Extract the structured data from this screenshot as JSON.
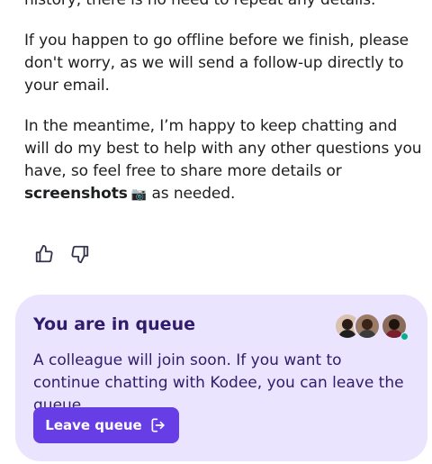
{
  "message": {
    "paragraph1": "history, there is no need to repeat any details.",
    "paragraph2": "If you happen to go offline before we finish, please don't worry, as we will send a follow-up directly to your email.",
    "paragraph3_before": "In the meantime, I’m happy to keep chatting and will do my best to help with any other questions you have, so feel free to share more details or ",
    "paragraph3_bold": "screenshots",
    "paragraph3_emoji": "📷",
    "paragraph3_after": " as needed."
  },
  "feedback": {
    "thumbs_up_icon": "thumbs-up-icon",
    "thumbs_down_icon": "thumbs-down-icon"
  },
  "queue": {
    "title": "You are in queue",
    "description": "A colleague will join soon. If you want to continue chatting with Kodee, you can leave the queue.",
    "leave_button_label": "Leave queue",
    "leave_icon": "exit-icon",
    "agent_status": "online"
  },
  "colors": {
    "accent": "#673de6",
    "card_background": "#ebe4ff",
    "title_text": "#2f1c6a",
    "online": "#00b090"
  }
}
